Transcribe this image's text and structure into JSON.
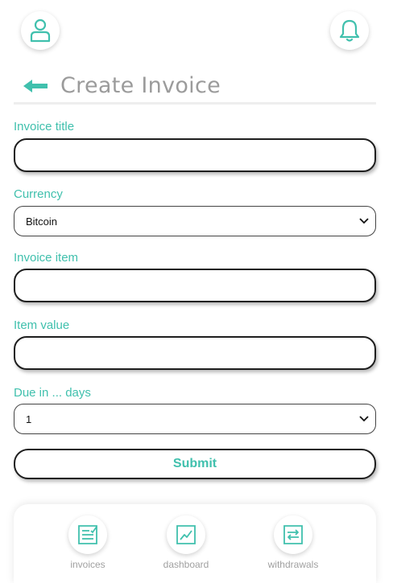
{
  "header": {
    "title": "Create Invoice"
  },
  "form": {
    "invoice_title": {
      "label": "Invoice title",
      "value": ""
    },
    "currency": {
      "label": "Currency",
      "selected": "Bitcoin"
    },
    "invoice_item": {
      "label": "Invoice item",
      "value": ""
    },
    "item_value": {
      "label": "Item value",
      "value": ""
    },
    "due_days": {
      "label": "Due in ... days",
      "selected": "1"
    },
    "submit_label": "Submit"
  },
  "bottom_nav": {
    "items": [
      {
        "label": "invoices",
        "icon": "invoice-list-icon"
      },
      {
        "label": "dashboard",
        "icon": "chart-icon"
      },
      {
        "label": "withdrawals",
        "icon": "transfer-icon"
      }
    ]
  },
  "colors": {
    "accent": "#40c0ad",
    "title_gray": "#9b9b9b",
    "border_dark": "#1e1e1e"
  }
}
